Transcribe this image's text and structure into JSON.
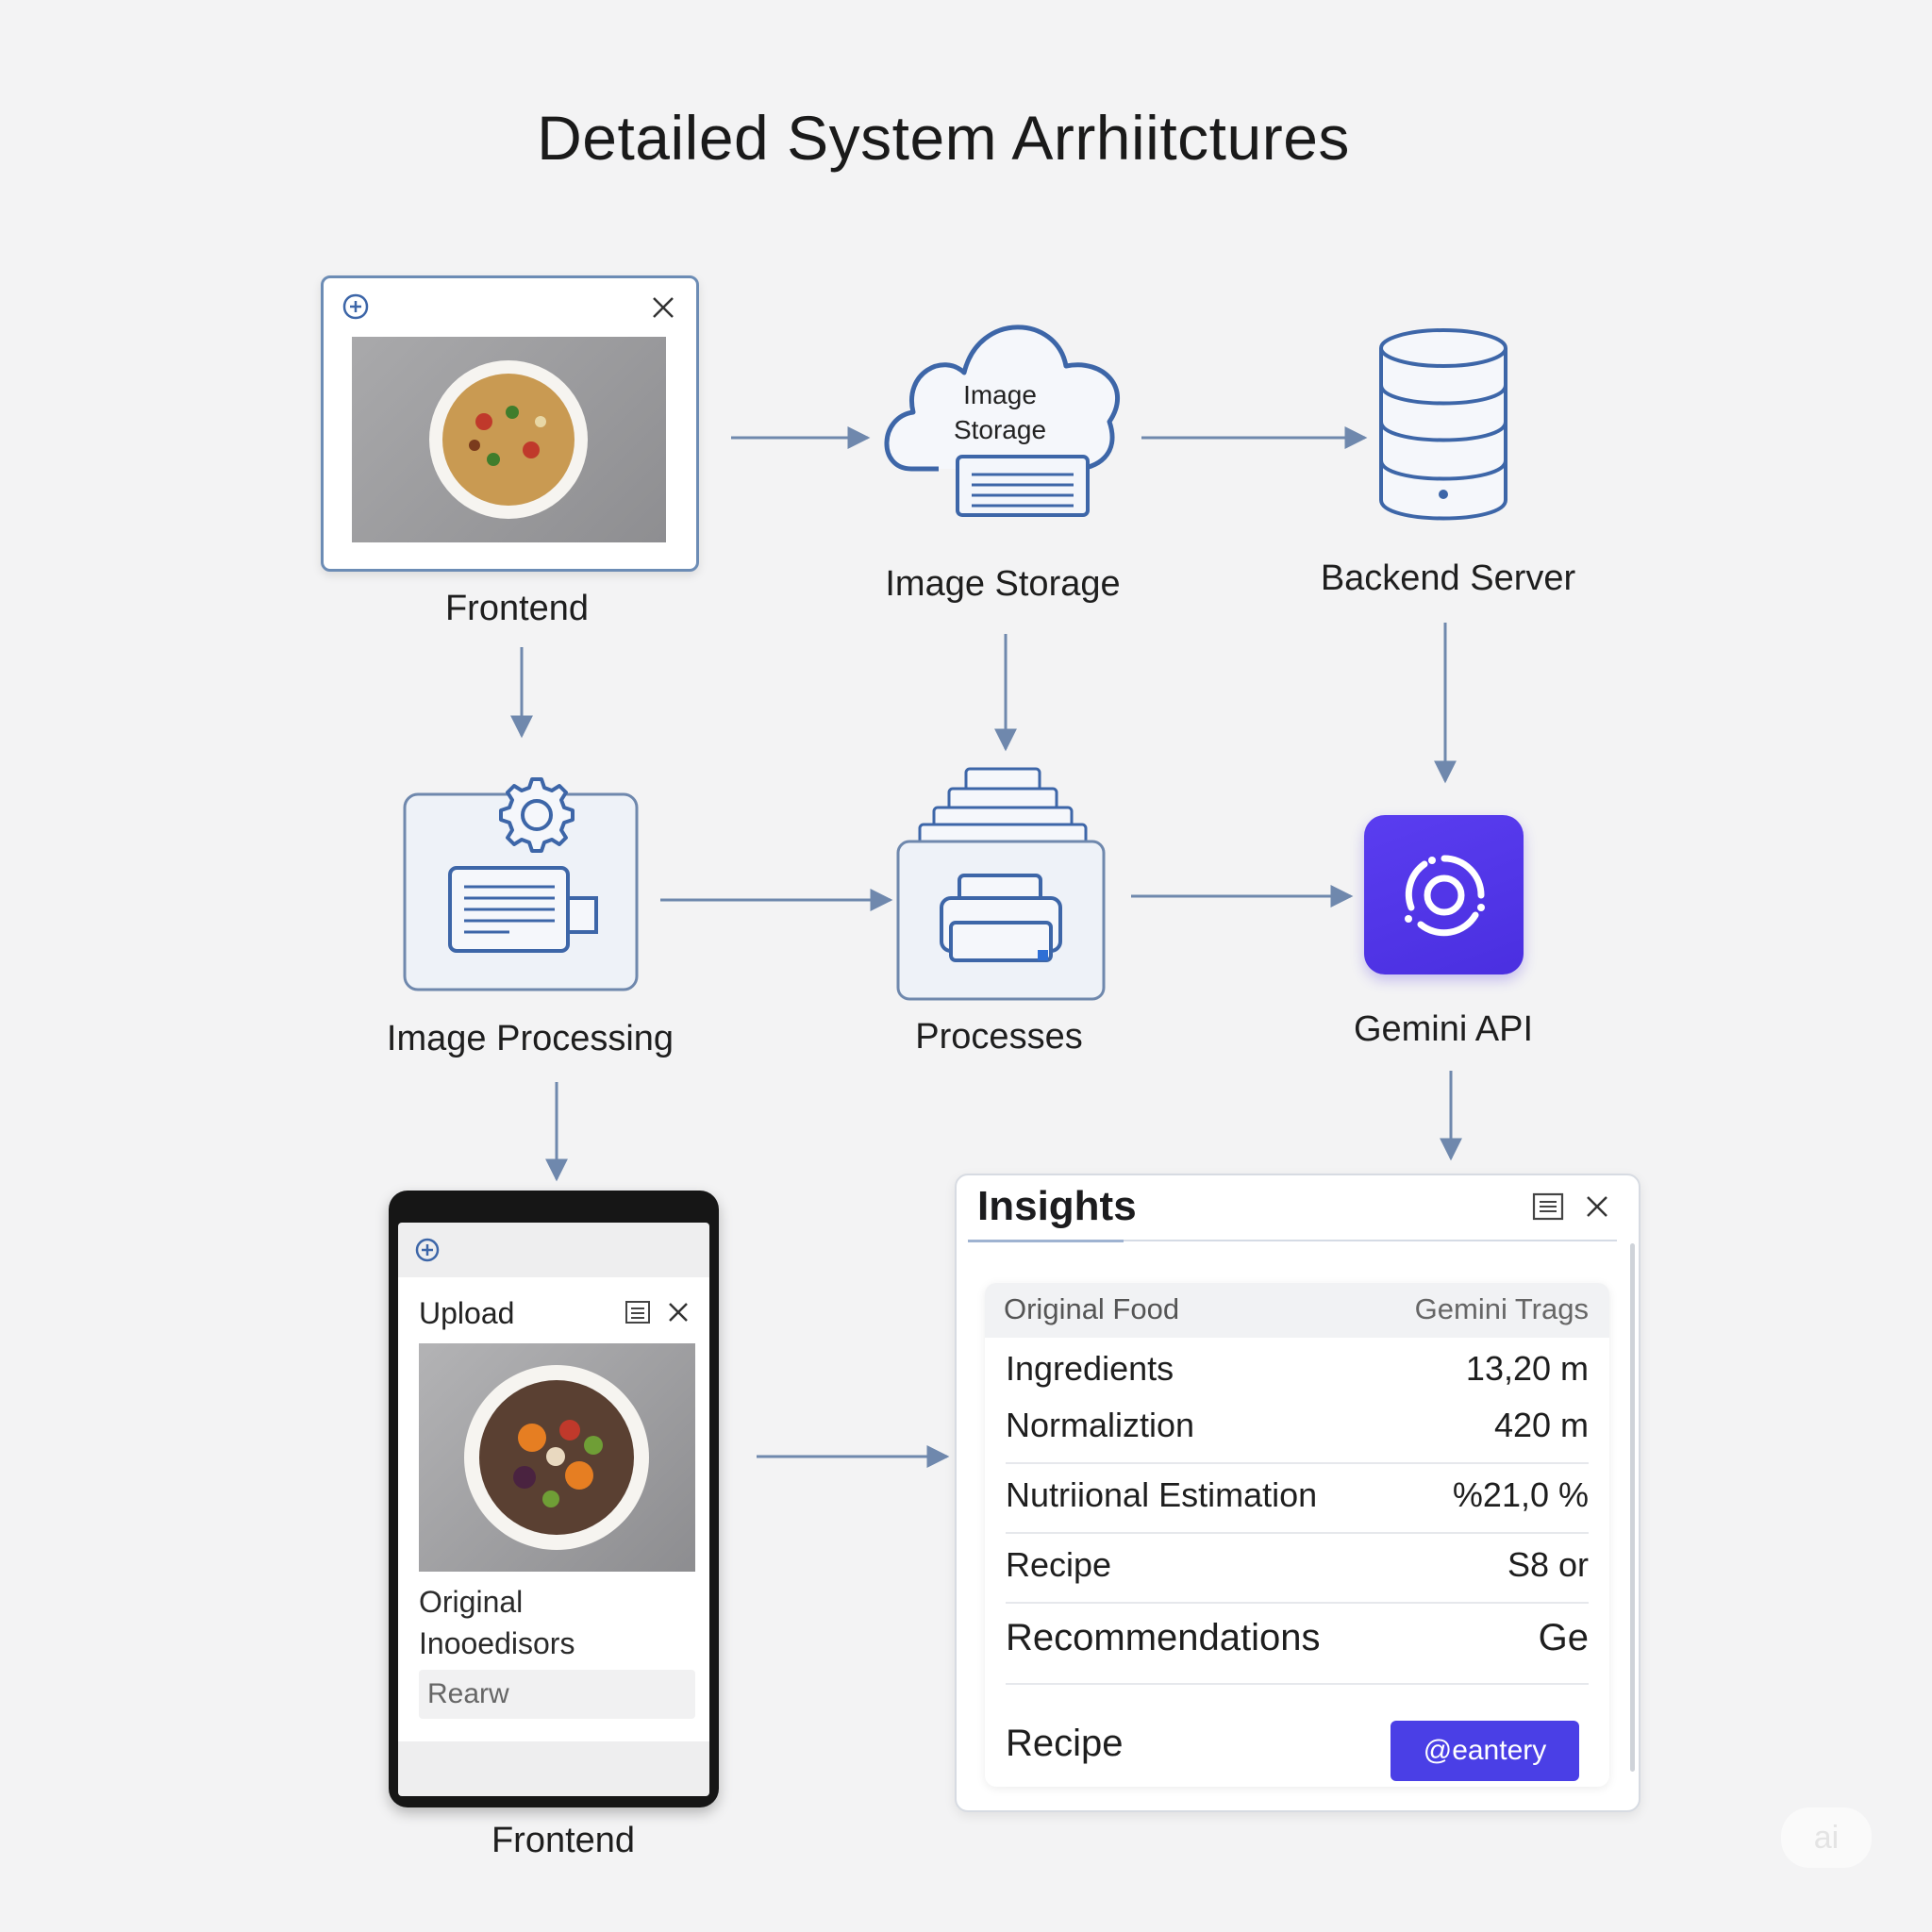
{
  "title": "Detailed System Arrhiitctures",
  "nodes": {
    "frontend_top": "Frontend",
    "cloud_text_line1": "Image",
    "cloud_text_line2": "Storage",
    "image_storage": "Image Storage",
    "backend_server": "Backend Server",
    "image_processing": "Image Processing",
    "processes": "Processes",
    "gemini_api": "Gemini API",
    "frontend_bottom": "Frontend"
  },
  "phone": {
    "title": "Upload",
    "text_line1": "Original",
    "text_line2": "Inooedisors",
    "input_value": "Rearw"
  },
  "insights": {
    "title": "Insights",
    "header_left": "Original Food",
    "header_right": "Gemini Trags",
    "rows": [
      {
        "label": "Ingredients",
        "value": "13,20 m"
      },
      {
        "label": "Normaliztion",
        "value": "420 m"
      },
      {
        "label": "Nutriional Estimation",
        "value": "%21,0 %"
      },
      {
        "label": "Recipe",
        "value": "S8 or"
      },
      {
        "label": "Recommendations",
        "value": "Ge"
      },
      {
        "label": "Recipe",
        "value": ""
      }
    ],
    "button_label": "@eantery"
  },
  "watermark": "ai",
  "colors": {
    "background": "#f3f3f4",
    "line": "#6f88ad",
    "icon_stroke": "#3d66a8",
    "accent": "#4a3fe6",
    "gemini_tile": "#5a3df0"
  },
  "icons": [
    "plus-circle-icon",
    "close-icon",
    "cloud-icon",
    "database-icon",
    "gear-icon",
    "document-icon",
    "printer-icon",
    "gemini-logo-icon",
    "list-icon"
  ]
}
